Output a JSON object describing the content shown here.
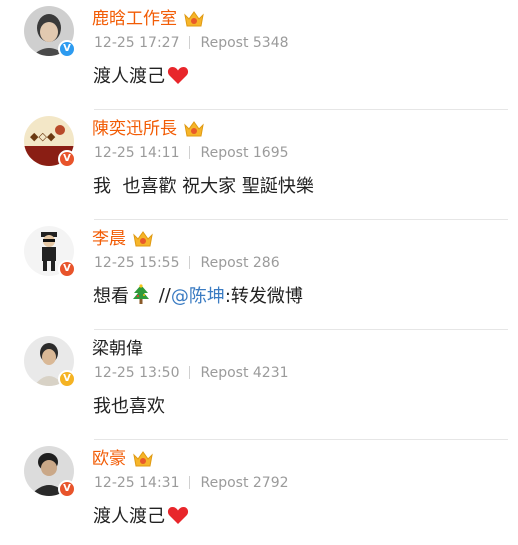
{
  "comments": [
    {
      "name": "鹿晗工作室",
      "time": "12-25 17:27",
      "repost": "Repost 5348",
      "text": "渡人渡己",
      "emoji": "heart-icon"
    },
    {
      "name": "陳奕迅所長",
      "time": "12-25 14:11",
      "repost": "Repost 1695",
      "text": "我  也喜歡 祝大家 聖誕快樂"
    },
    {
      "name": "李晨",
      "time": "12-25 15:55",
      "repost": "Repost 286",
      "text_before": "想看",
      "emoji": "christmas-tree-icon",
      "text_slashes": " //",
      "mention": "@陈坤",
      "text_after": ":转发微博"
    },
    {
      "name": "梁朝偉",
      "time": "12-25 13:50",
      "repost": "Repost 4231",
      "text": "我也喜欢"
    },
    {
      "name": "欧豪",
      "time": "12-25 14:31",
      "repost": "Repost 2792",
      "text": "渡人渡己",
      "emoji": "heart-icon"
    }
  ],
  "colors": {
    "vip_name": "#f25c05",
    "regular_name": "#222222",
    "meta": "#9b9b9b",
    "mention": "#3a7bc2",
    "heart": "#e8262b",
    "verified_blue": "#2d9bf0",
    "verified_red": "#e8542b",
    "verified_gold": "#f5b323"
  }
}
